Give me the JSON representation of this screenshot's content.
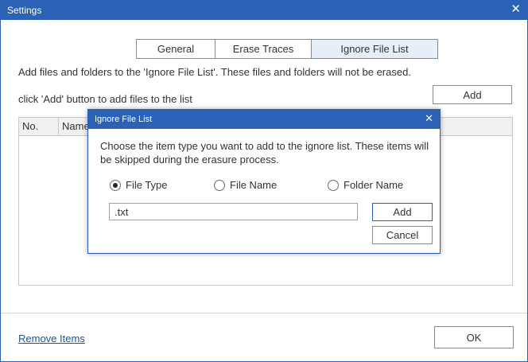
{
  "window": {
    "title": "Settings",
    "close_glyph": "✕"
  },
  "tabs": [
    {
      "label": "General",
      "active": false
    },
    {
      "label": "Erase Traces",
      "active": false
    },
    {
      "label": "Ignore File List",
      "active": true
    }
  ],
  "main": {
    "description": "Add files and folders to the 'Ignore File List'. These files and folders will not be erased.",
    "instruction": "click 'Add' button to add files to the list",
    "add_button": "Add",
    "columns": [
      "No.",
      "Name"
    ],
    "remove_items_link": "Remove Items",
    "ok_button": "OK"
  },
  "dialog": {
    "title": "Ignore File List",
    "close_glyph": "✕",
    "text": "Choose the item type you want to add to the ignore list. These items will be skipped during the erasure process.",
    "options": [
      {
        "label": "File Type",
        "checked": true
      },
      {
        "label": "File Name",
        "checked": false
      },
      {
        "label": "Folder Name",
        "checked": false
      }
    ],
    "input_value": ".txt",
    "add_button": "Add",
    "cancel_button": "Cancel"
  },
  "colors": {
    "titlebar": "#2b62b5",
    "active_tab": "#e6eef8",
    "link": "#1a55a8"
  }
}
